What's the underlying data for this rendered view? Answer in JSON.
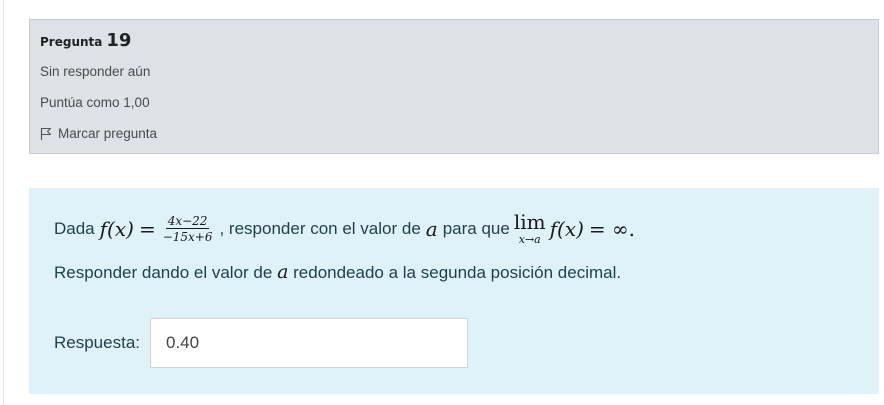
{
  "question_info": {
    "label": "Pregunta",
    "number": "19",
    "state": "Sin responder aún",
    "grade": "Puntúa como 1,00",
    "flag_label": "Marcar pregunta"
  },
  "question": {
    "intro": "Dada",
    "f_of_x": "f(x)",
    "equals": "=",
    "numerator": "4x−22",
    "denominator": "−15x+6",
    "mid_text": ", responder con el valor de",
    "var_a": "a",
    "post_text": "para que",
    "lim_word": "lim",
    "lim_sub": "x→a",
    "lim_fx": "f(x)",
    "lim_result": "= ∞.",
    "instruction_pre": "Responder dando el valor de",
    "instruction_var": "a",
    "instruction_post": "redondeado a la segunda posición decimal.",
    "answer_label": "Respuesta:",
    "answer_value": "0.40"
  }
}
